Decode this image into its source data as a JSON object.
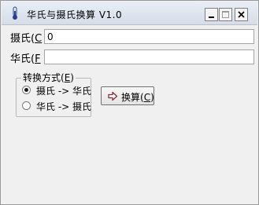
{
  "window": {
    "title": "华氏与摄氏换算 V1.0",
    "icons": {
      "app": "thermometer-icon",
      "minimize": "minimize-icon",
      "maximize": "maximize-icon",
      "close": "close-icon"
    }
  },
  "fields": {
    "celsius": {
      "label": "摄氏",
      "accelerator": "C",
      "value": "0"
    },
    "fahrenheit": {
      "label": "华氏",
      "accelerator": "F",
      "value": ""
    }
  },
  "conversion": {
    "group_title": "转换方式",
    "group_accelerator": "E",
    "options": [
      {
        "label": "摄氏 -> 华氏",
        "selected": true
      },
      {
        "label": "华氏 -> 摄氏",
        "selected": false
      }
    ]
  },
  "convert_button": {
    "label": "换算",
    "accelerator": "C",
    "icon": "arrow-right-icon"
  },
  "colors": {
    "arrow": "#8b2b3a"
  }
}
